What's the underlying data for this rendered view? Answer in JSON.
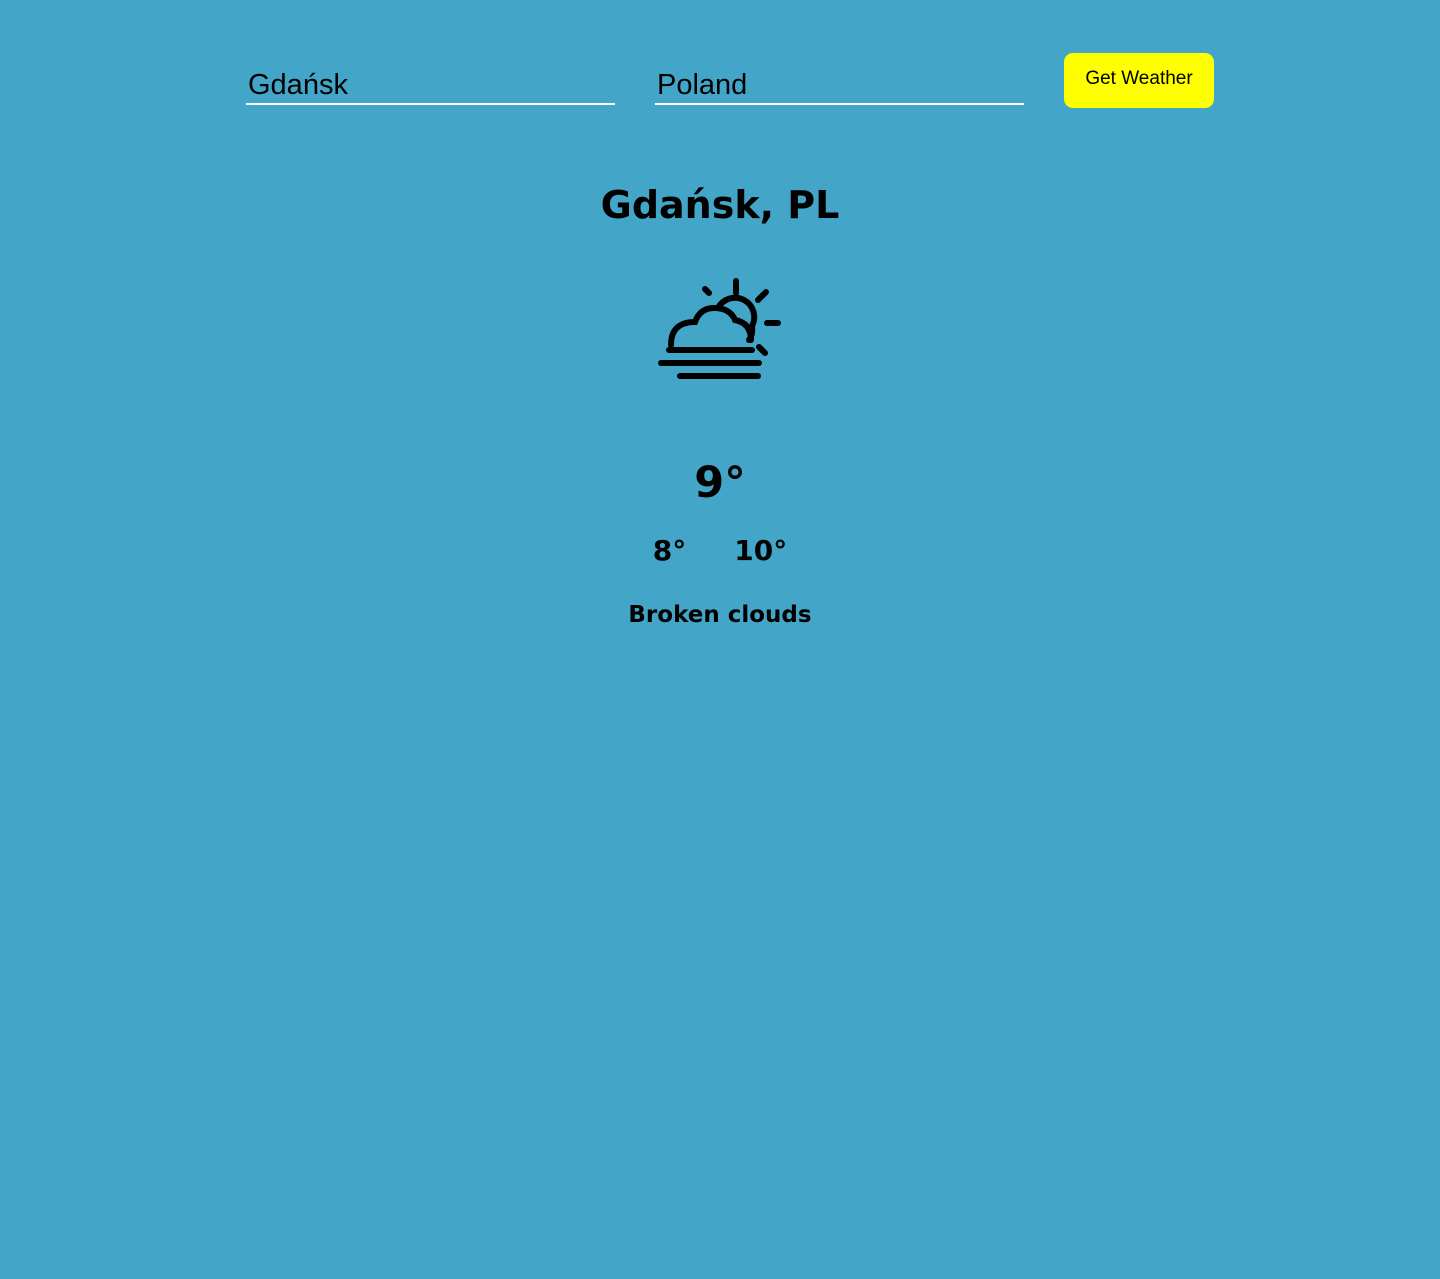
{
  "search": {
    "city_value": "Gdańsk",
    "country_value": "Poland",
    "button_label": "Get Weather"
  },
  "weather": {
    "location": "Gdańsk, PL",
    "icon": "fog-partly-cloudy-icon",
    "temperature": "9°",
    "min_temp": "8°",
    "max_temp": "10°",
    "description": "Broken clouds"
  },
  "colors": {
    "background": "#43a6c9",
    "button": "#ffff00",
    "input_underline": "#ffffff",
    "text": "#000000"
  }
}
